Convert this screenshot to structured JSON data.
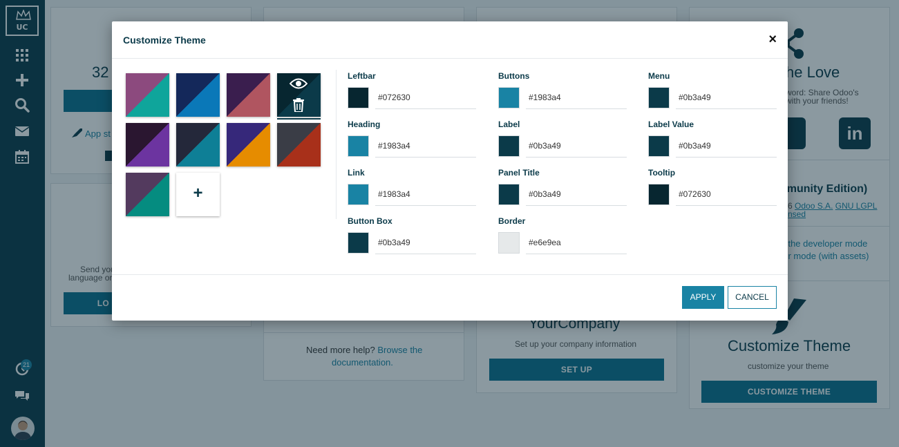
{
  "sidebar": {
    "logo_text": "UC",
    "icons": [
      "apps-icon",
      "plus-icon",
      "search-icon",
      "mail-icon",
      "calendar-icon",
      "activity-icon",
      "chat-icon"
    ],
    "activity_badge": "21"
  },
  "background": {
    "card1": {
      "stat": "32",
      "app_link": "App st",
      "invite_text_1": "Send you",
      "invite_text_2": "language or",
      "invite_button": "LO"
    },
    "card2": {
      "help_text": "Need more help?",
      "help_link_1": "Browse the",
      "help_link_2": "documentation."
    },
    "card3": {
      "title": "YourCompany",
      "subtitle": "Set up your company information",
      "button": "SET UP"
    },
    "card4": {
      "share_title": "he Love",
      "share_text_1": "word: Share Odoo's",
      "share_text_2": "with your friends!",
      "edition_title": "nmunity Edition)",
      "license_text_prefix": "6",
      "license_link_1": "Odoo S.A.",
      "license_link_2": "GNU LGPL",
      "license_text_2": "nsed",
      "dev_mode_1": "te the developer mode",
      "dev_mode_2": "per mode (with assets)",
      "theme_title": "Customize Theme",
      "theme_subtitle": "customize your theme",
      "theme_button": "CUSTOMIZE THEME"
    }
  },
  "modal": {
    "title": "Customize Theme",
    "close_icon": "×",
    "add_symbol": "+",
    "swatches": [
      {
        "c1": "#8c4a7e",
        "c2": "#0fa59b"
      },
      {
        "c1": "#14285a",
        "c2": "#0a78b8"
      },
      {
        "c1": "#3a1e4e",
        "c2": "#b05560"
      },
      {
        "c1": "#072630",
        "c2": "#0b3a49",
        "active": true
      },
      {
        "c1": "#2a1630",
        "c2": "#6c34a0"
      },
      {
        "c1": "#24283a",
        "c2": "#0e7f96"
      },
      {
        "c1": "#36287a",
        "c2": "#e68c00"
      },
      {
        "c1": "#3a3d46",
        "c2": "#a8301a"
      },
      {
        "c1": "#533a5e",
        "c2": "#058c80"
      }
    ],
    "fields": [
      {
        "label": "Leftbar",
        "value": "#072630"
      },
      {
        "label": "Buttons",
        "value": "#1983a4"
      },
      {
        "label": "Menu",
        "value": "#0b3a49"
      },
      {
        "label": "Heading",
        "value": "#1983a4"
      },
      {
        "label": "Label",
        "value": "#0b3a49"
      },
      {
        "label": "Label Value",
        "value": "#0b3a49"
      },
      {
        "label": "Link",
        "value": "#1983a4"
      },
      {
        "label": "Panel Title",
        "value": "#0b3a49"
      },
      {
        "label": "Tooltip",
        "value": "#072630"
      },
      {
        "label": "Button Box",
        "value": "#0b3a49"
      },
      {
        "label": "Border",
        "value": "#e6e9ea"
      }
    ],
    "apply_label": "APPLY",
    "cancel_label": "CANCEL"
  }
}
